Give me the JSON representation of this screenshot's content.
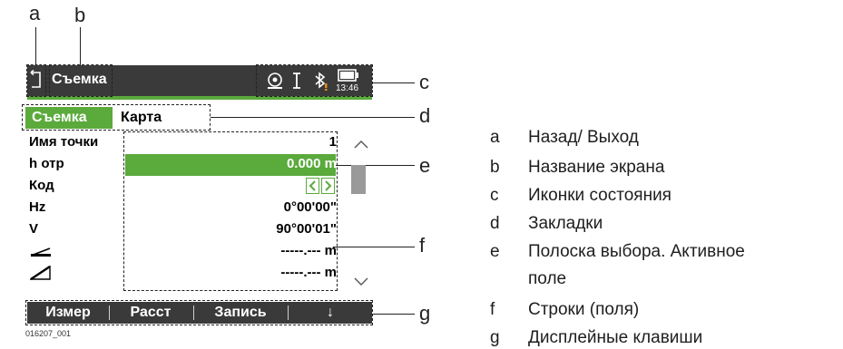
{
  "callouts": {
    "a": "a",
    "b": "b",
    "c": "c",
    "d": "d",
    "e": "e",
    "f": "f",
    "g": "g"
  },
  "titlebar": {
    "title": "Съемка",
    "time": "13:46"
  },
  "icons": {
    "back": "back-arrow-icon",
    "status": [
      "target-icon",
      "cursor-icon",
      "bluetooth-icon",
      "battery-icon"
    ]
  },
  "tabs": [
    {
      "label": "Съемка",
      "active": true
    },
    {
      "label": "Карта",
      "active": false
    }
  ],
  "rows": [
    {
      "label": "Имя точки",
      "value": "1"
    },
    {
      "label": "h отр",
      "value": "0.000 m"
    },
    {
      "label": "Код",
      "value": ""
    },
    {
      "label": "Hz",
      "value": "0°00'00\""
    },
    {
      "label": "V",
      "value": "90°00'01\""
    },
    {
      "label": "",
      "value": "-----.--- m"
    },
    {
      "label": "",
      "value": "-----.--- m"
    }
  ],
  "softkeys": [
    "Измер",
    "Расст",
    "Запись",
    "↓"
  ],
  "figure_id": "016207_001",
  "legend": [
    {
      "key": "a",
      "text": "Назад/ Выход"
    },
    {
      "key": "b",
      "text": "Название экрана"
    },
    {
      "key": "c",
      "text": "Иконки состояния"
    },
    {
      "key": "d",
      "text": "Закладки"
    },
    {
      "key": "e",
      "text": "Полоска выбора. Активное"
    },
    {
      "key": "",
      "text": "поле"
    },
    {
      "key": "f",
      "text": "Строки (поля)"
    },
    {
      "key": "g",
      "text": "Дисплейные клавиши"
    }
  ],
  "colors": {
    "accent": "#5aaa3c",
    "titlebar": "#3a3a3a",
    "scroll": "#9a9a9a"
  }
}
